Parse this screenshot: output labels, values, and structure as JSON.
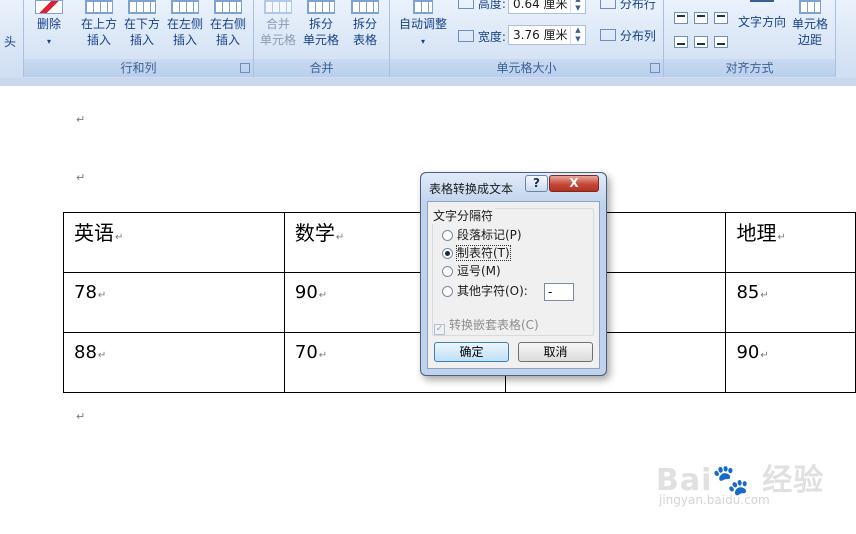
{
  "ribbon": {
    "partial_left": "头",
    "groups": {
      "rows_cols": {
        "label": "行和列",
        "delete": "删除",
        "insert_above": [
          "在上方",
          "插入"
        ],
        "insert_below": [
          "在下方",
          "插入"
        ],
        "insert_left": [
          "在左侧",
          "插入"
        ],
        "insert_right": [
          "在右侧",
          "插入"
        ]
      },
      "merge": {
        "label": "合并",
        "merge_cells": [
          "合并",
          "单元格"
        ],
        "split_cells": [
          "拆分",
          "单元格"
        ],
        "split_table": [
          "拆分",
          "表格"
        ]
      },
      "cell_size": {
        "label": "单元格大小",
        "autofit": "自动调整",
        "height_label": "高度:",
        "height_value": "0.64 厘米",
        "width_label": "宽度:",
        "width_value": "3.76 厘米",
        "distribute_rows": "分布行",
        "distribute_cols": "分布列"
      },
      "alignment": {
        "label": "对齐方式",
        "text_direction": "文字方向",
        "cell_margins": [
          "单元格",
          "边距"
        ]
      }
    }
  },
  "document": {
    "table": {
      "rows": [
        [
          "英语",
          "数学",
          "",
          "地理"
        ],
        [
          "78",
          "90",
          "",
          "85"
        ],
        [
          "88",
          "70",
          "",
          "90"
        ]
      ]
    },
    "paragraph_mark": "↵"
  },
  "dialog": {
    "title": "表格转换成文本",
    "help": "?",
    "close": "X",
    "group_label": "文字分隔符",
    "options": [
      {
        "label": "段落标记(P)",
        "selected": false
      },
      {
        "label": "制表符(T)",
        "selected": true
      },
      {
        "label": "逗号(M)",
        "selected": false
      },
      {
        "label": "其他字符(O):",
        "selected": false
      }
    ],
    "other_char_value": "-",
    "nested_label": "转换嵌套表格(C)",
    "ok": "确定",
    "cancel": "取消"
  },
  "watermark": {
    "logo": "Bai🐾 经验",
    "url": "jingyan.baidu.com"
  }
}
